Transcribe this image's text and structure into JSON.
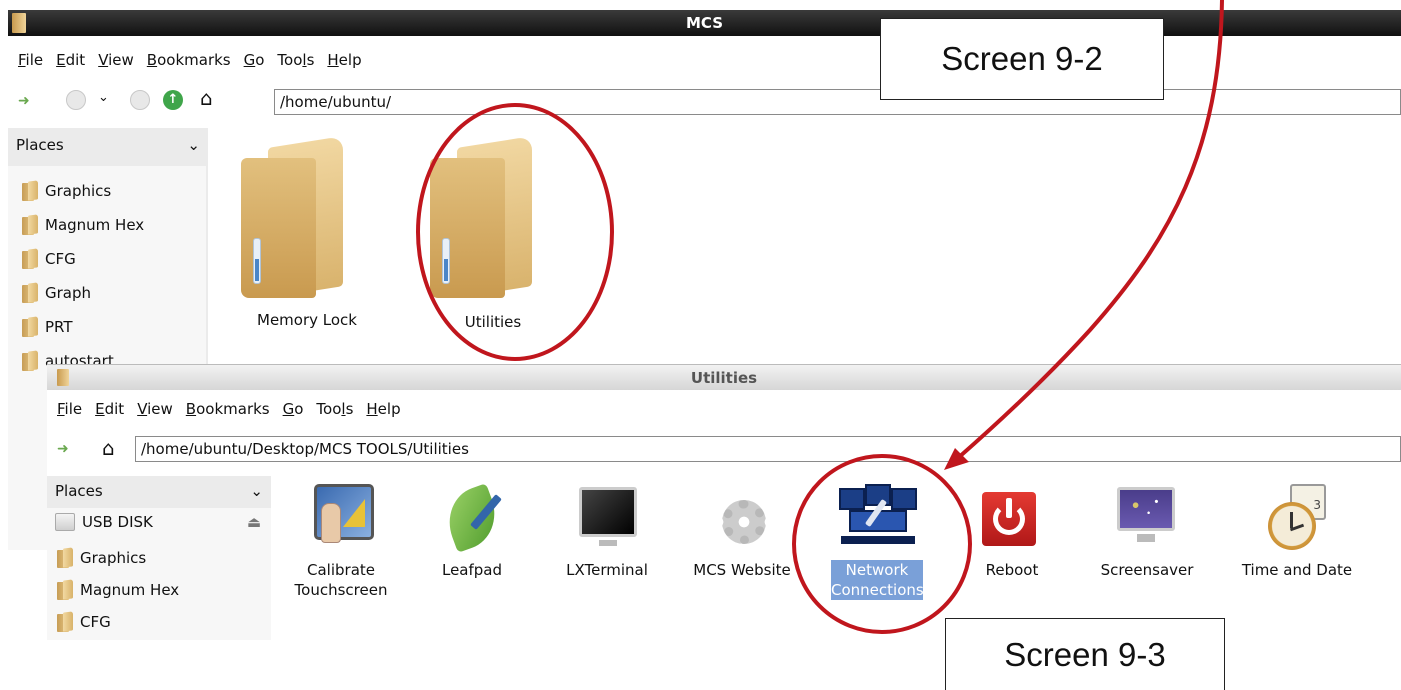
{
  "back_window": {
    "title": "MCS",
    "menu": [
      "File",
      "Edit",
      "View",
      "Bookmarks",
      "Go",
      "Tools",
      "Help"
    ],
    "menu_access": [
      "F",
      "E",
      "V",
      "B",
      "G",
      "l",
      "H"
    ],
    "address": "/home/ubuntu/",
    "places_title": "Places",
    "places": [
      "Graphics",
      "Magnum Hex",
      "CFG",
      "Graph",
      "PRT",
      "autostart"
    ],
    "files": [
      {
        "label": "Memory Lock"
      },
      {
        "label": "Utilities"
      }
    ]
  },
  "front_window": {
    "title": "Utilities",
    "menu": [
      "File",
      "Edit",
      "View",
      "Bookmarks",
      "Go",
      "Tools",
      "Help"
    ],
    "address": "/home/ubuntu/Desktop/MCS TOOLS/Utilities",
    "places_title": "Places",
    "places": [
      "USB DISK",
      "Graphics",
      "Magnum Hex",
      "CFG"
    ],
    "apps": [
      {
        "label_line1": "Calibrate",
        "label_line2": "Touchscreen",
        "icon": "calibrate-icon"
      },
      {
        "label_line1": "Leafpad",
        "label_line2": "",
        "icon": "leafpad-icon"
      },
      {
        "label_line1": "LXTerminal",
        "label_line2": "",
        "icon": "terminal-icon"
      },
      {
        "label_line1": "MCS Website",
        "label_line2": "",
        "icon": "gear-icon"
      },
      {
        "label_line1": "Network",
        "label_line2": "Connections",
        "icon": "network-icon",
        "selected": true
      },
      {
        "label_line1": "Reboot",
        "label_line2": "",
        "icon": "power-icon"
      },
      {
        "label_line1": "Screensaver",
        "label_line2": "",
        "icon": "screensaver-icon"
      },
      {
        "label_line1": "Time and Date",
        "label_line2": "",
        "icon": "clock-icon"
      }
    ]
  },
  "callouts": {
    "screen_9_2": "Screen 9-2",
    "screen_9_3": "Screen 9-3"
  },
  "colors": {
    "highlight_ring": "#c0161d",
    "selection": "#7aa0d8",
    "titlebar_dark": "#1e1e1e"
  }
}
